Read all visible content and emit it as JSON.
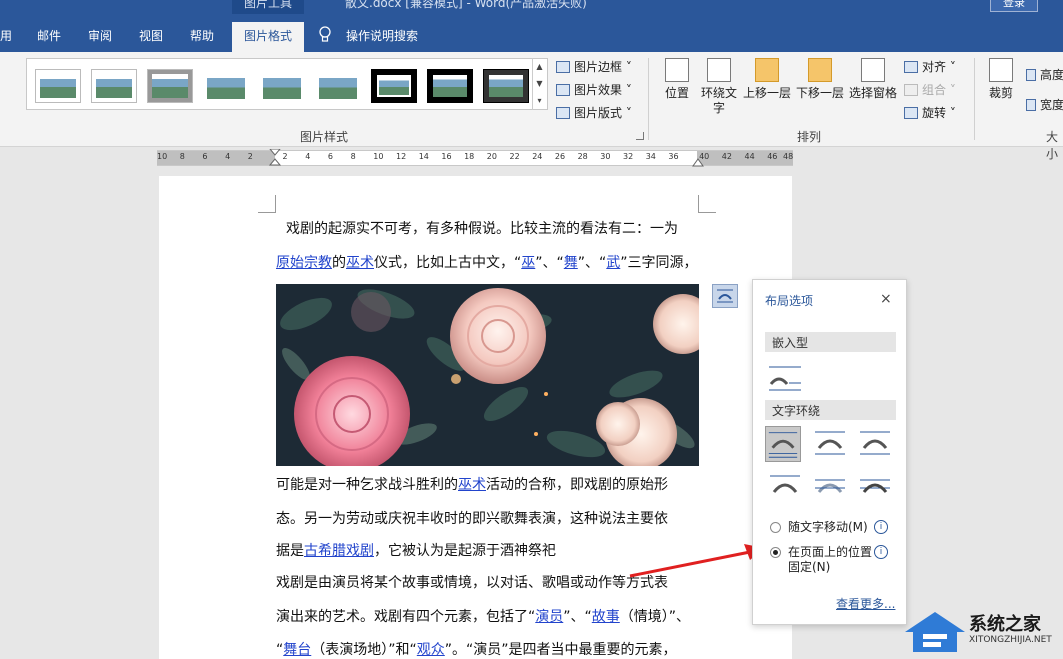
{
  "titlebar": {
    "context_tab": "图片工具",
    "document_title": "散文.docx [兼容模式] - Word(产品激活失败)",
    "login": "登录"
  },
  "tabs": [
    {
      "label": "用"
    },
    {
      "label": "邮件"
    },
    {
      "label": "审阅"
    },
    {
      "label": "视图"
    },
    {
      "label": "帮助"
    },
    {
      "label": "图片格式",
      "active": true
    },
    {
      "label": "操作说明搜索"
    }
  ],
  "ribbon": {
    "picture_styles_group": "图片样式",
    "border": "图片边框",
    "effects": "图片效果",
    "layout": "图片版式",
    "arrange_group": "排列",
    "position": "位置",
    "wrap_text": "环绕文字",
    "bring_forward": "上移一层",
    "send_backward": "下移一层",
    "selection_pane": "选择窗格",
    "align": "对齐",
    "group": "组合",
    "rotate": "旋转",
    "crop": "裁剪",
    "height": "高度",
    "width": "宽度",
    "size_group": "大小"
  },
  "ruler": {
    "numbers": [
      "10",
      "8",
      "6",
      "4",
      "2",
      "2",
      "4",
      "6",
      "8",
      "10",
      "12",
      "14",
      "16",
      "18",
      "20",
      "22",
      "24",
      "26",
      "28",
      "30",
      "32",
      "34",
      "36",
      "40",
      "42",
      "44",
      "46",
      "48"
    ]
  },
  "document": {
    "p1": "戏剧的起源实不可考，有多种假说。比较主流的看法有二：一为",
    "p2_link1": "原始宗教",
    "p2_t1": "的",
    "p2_link2": "巫术",
    "p2_t2": "仪式，比如上古中文，“",
    "p2_link3": "巫",
    "p2_t3": "”、“",
    "p2_link4": "舞",
    "p2_t4": "”、“",
    "p2_link5": "武",
    "p2_t5": "”三字同源，",
    "p3_t1": "可能是对一种乞求战斗胜利的",
    "p3_link": "巫术",
    "p3_t2": "活动的合称，即戏剧的原始形",
    "p4": "态。另一为劳动或庆祝丰收时的即兴歌舞表演，这种说法主要依",
    "p5_t1": "据是",
    "p5_link": "古希腊戏剧",
    "p5_t2": "，它被认为是起源于酒神祭祀",
    "p6": "戏剧是由演员将某个故事或情境，以对话、歌唱或动作等方式表",
    "p7_t1": "演出来的艺术。戏剧有四个元素，包括了“",
    "p7_link1": "演员",
    "p7_t2": "”、“",
    "p7_link2": "故事",
    "p7_t3": "（情境）”、",
    "p8_t1": "“",
    "p8_link1": "舞台",
    "p8_t2": "（表演场地）”和“",
    "p8_link2": "观众",
    "p8_t3": "”。“演员”是四者当中最重要的元素，"
  },
  "layout_panel": {
    "title": "布局选项",
    "close": "×",
    "inline_section": "嵌入型",
    "wrap_section": "文字环绕",
    "move_with_text": "随文字移动(M)",
    "fix_position_line1": "在页面上的位置",
    "fix_position_line2": "固定(N)",
    "info": "i",
    "see_more": "查看更多...",
    "selected_option": "fix_position"
  },
  "watermark": {
    "brand": "系统之家",
    "url": "XITONGZHIJIA.NET"
  },
  "colors": {
    "word_blue": "#2b579a",
    "link_blue": "#2244cc",
    "arrow_red": "#e02020"
  }
}
